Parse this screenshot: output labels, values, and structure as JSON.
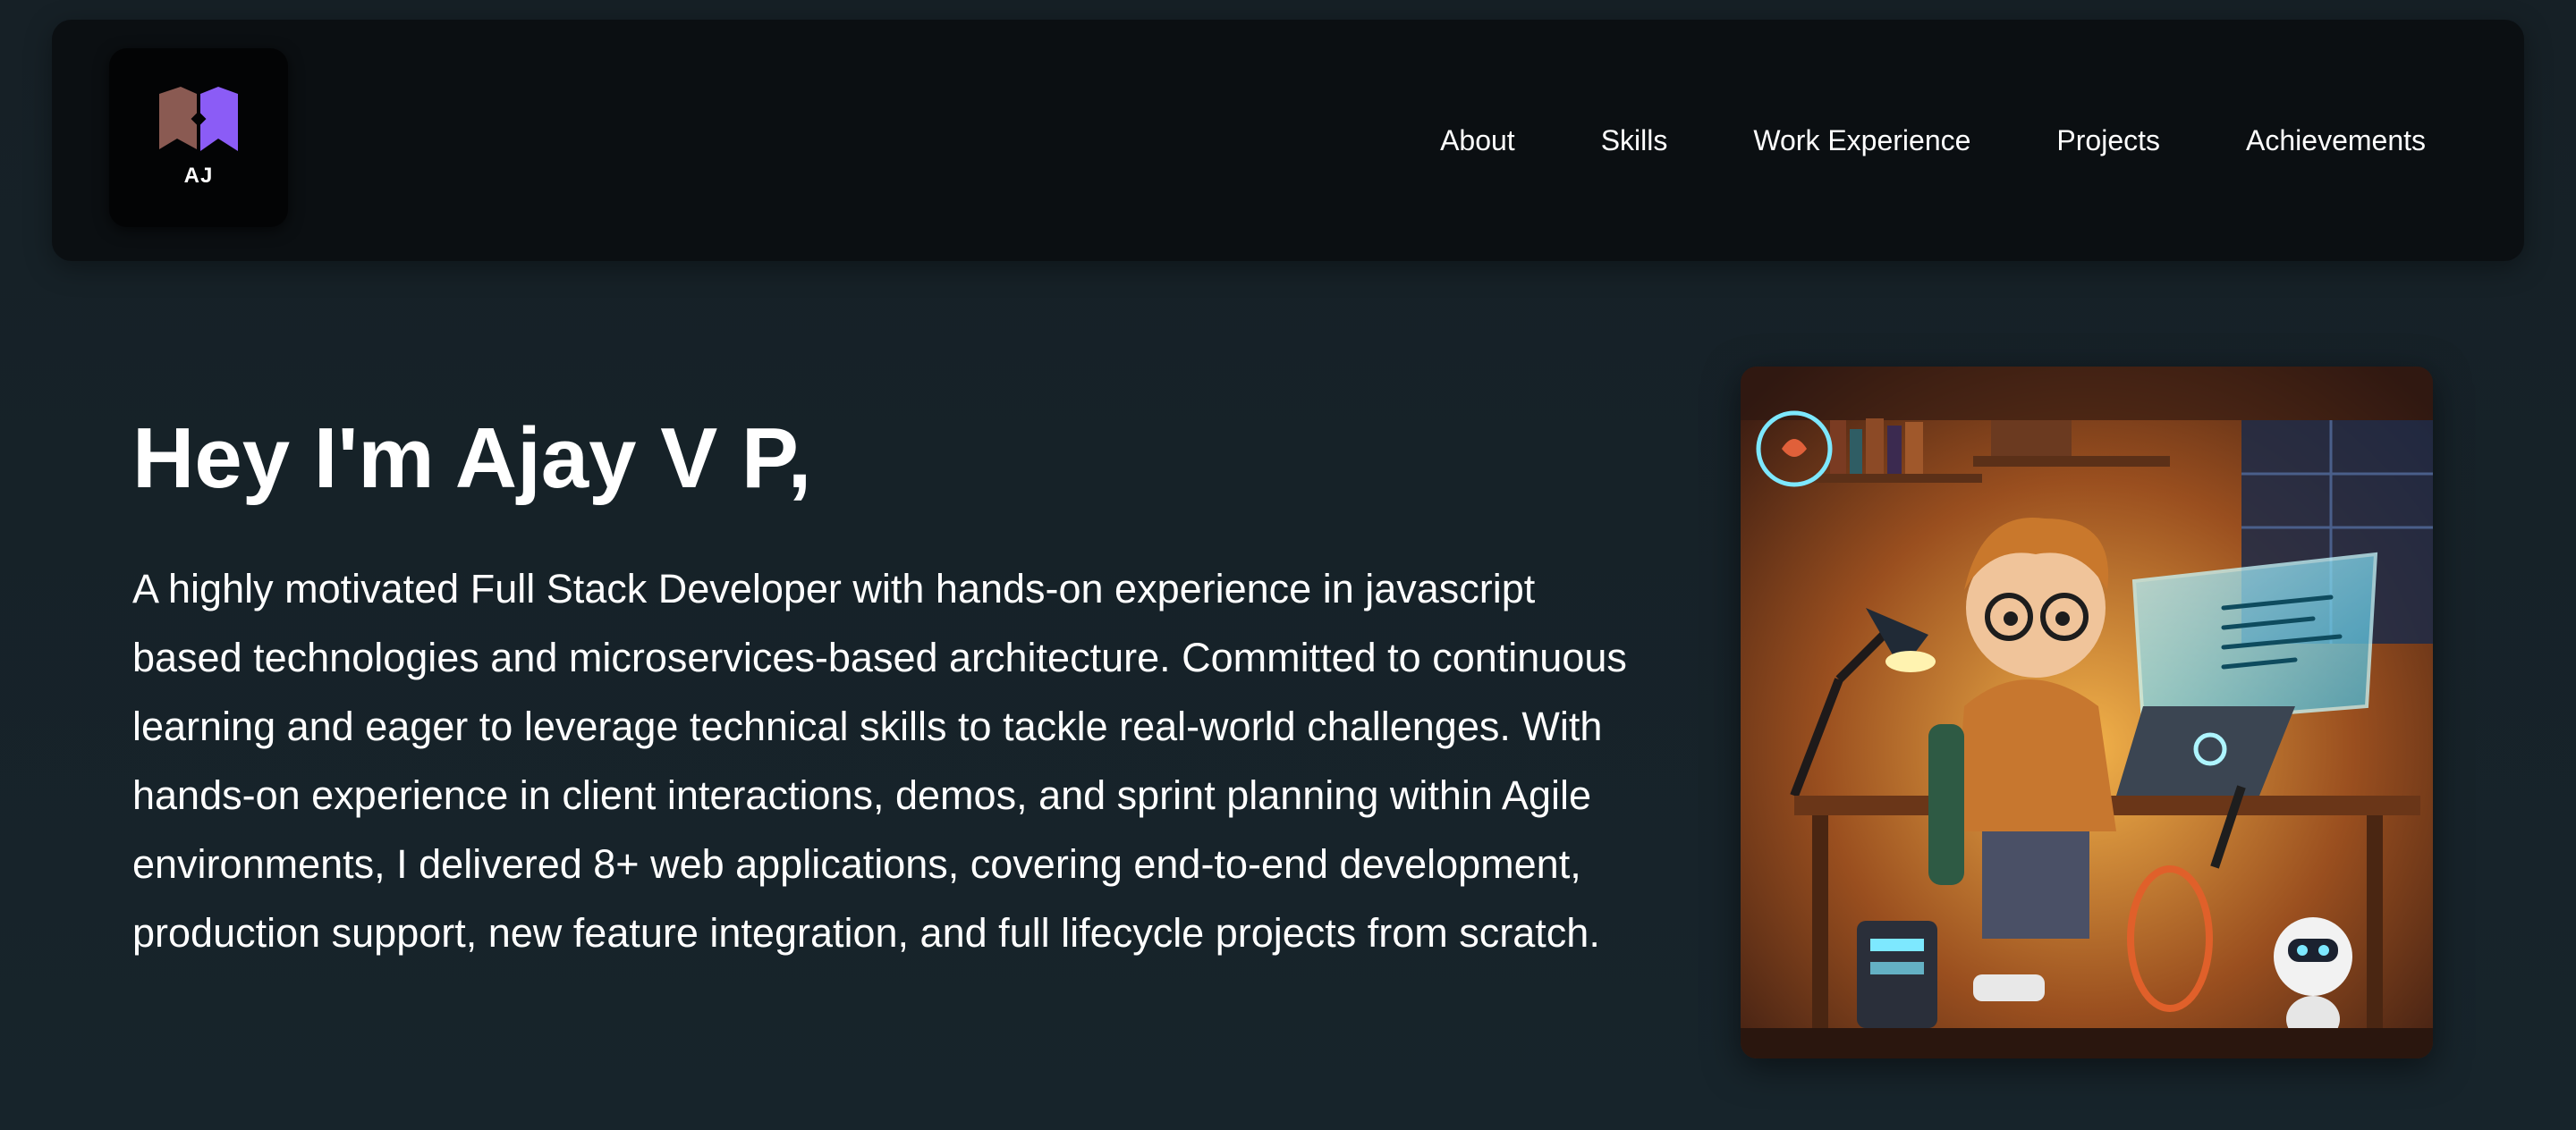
{
  "logo": {
    "text": "AJ",
    "icon": "bookmark-monogram-icon",
    "colors": {
      "left": "#8a5a52",
      "right": "#8b5cf6"
    }
  },
  "nav": {
    "items": [
      {
        "label": "About"
      },
      {
        "label": "Skills"
      },
      {
        "label": "Work Experience"
      },
      {
        "label": "Projects"
      },
      {
        "label": "Achievements"
      }
    ]
  },
  "hero": {
    "title": "Hey I'm Ajay V P,",
    "description": "A highly motivated Full Stack Developer with hands-on experience in javascript based technologies and microservices-based architecture. Committed to continuous learning and eager to leverage technical skills to tackle real-world challenges. With hands-on experience in client interactions, demos, and sprint planning within Agile environments, I delivered 8+ web applications, covering end-to-end development, production support, new feature integration, and full lifecycle projects from scratch.",
    "image": {
      "icon": "developer-illustration",
      "colors": {
        "warm": "#e08a2a",
        "neon": "#7de8ff"
      }
    }
  },
  "theme": {
    "background": "#17232a",
    "navbar_background": "#0b0f12",
    "text": "#ffffff"
  }
}
